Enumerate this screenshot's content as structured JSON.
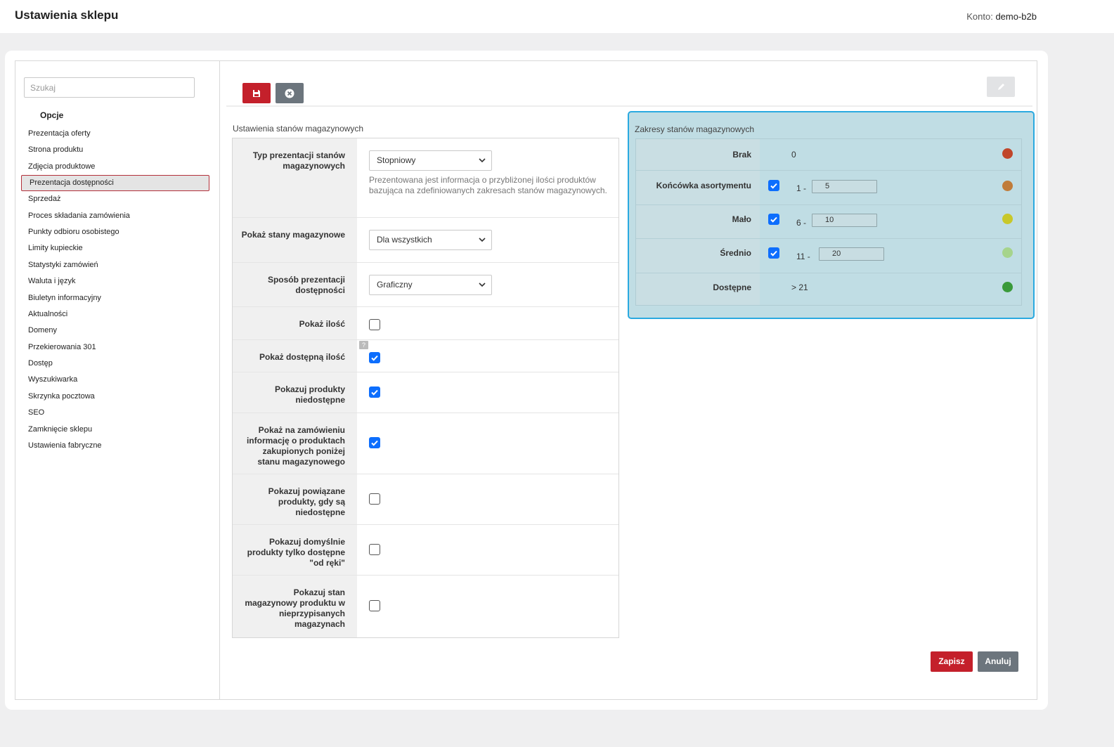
{
  "header": {
    "title": "Ustawienia sklepu",
    "account_label": "Konto:",
    "account_value": "demo-b2b"
  },
  "sidebar": {
    "search_placeholder": "Szukaj",
    "section": "Opcje",
    "items": [
      "Prezentacja oferty",
      "Strona produktu",
      "Zdjęcia produktowe",
      "Prezentacja dostępności",
      "Sprzedaż",
      "Proces składania zamówienia",
      "Punkty odbioru osobistego",
      "Limity kupieckie",
      "Statystyki zamówień",
      "Waluta i język",
      "Biuletyn informacyjny",
      "Aktualności",
      "Domeny",
      "Przekierowania 301",
      "Dostęp",
      "Wyszukiwarka",
      "Skrzynka pocztowa",
      "SEO",
      "Zamknięcie sklepu",
      "Ustawienia fabryczne"
    ],
    "active_index": 3
  },
  "toolbar": {
    "save_icon": "floppy-disk-icon",
    "cancel_icon": "x-circle-icon",
    "edit_icon": "pencil-icon"
  },
  "stock": {
    "title": "Ustawienia stanów magazynowych",
    "type_label": "Typ prezentacji stanów magazynowych",
    "type_value": "Stopniowy",
    "type_hint": "Prezentowana jest informacja o przybliżonej ilości produktów bazująca na zdefiniowanych zakresach stanów magazynowych.",
    "show_label": "Pokaż stany magazynowe",
    "show_value": "Dla wszystkich",
    "mode_label": "Sposób prezentacji dostępności",
    "mode_value": "Graficzny",
    "qty_label": "Pokaż ilość",
    "qty_checked": false,
    "avail_qty_label": "Pokaż dostępną ilość",
    "avail_qty_checked": true,
    "help": "?",
    "unavailable_label": "Pokazuj produkty niedostępne",
    "unavailable_checked": true,
    "order_info_label": "Pokaż na zamówieniu informację o produktach zakupionych poniżej stanu magazynowego",
    "order_info_checked": true,
    "related_label": "Pokazuj powiązane produkty, gdy są niedostępne",
    "related_checked": false,
    "default_label": "Pokazuj domyślnie produkty tylko dostępne \"od ręki\"",
    "default_checked": false,
    "unassigned_label": "Pokazuj stan magazynowy produktu w nieprzypisanych magazynach",
    "unassigned_checked": false
  },
  "ranges": {
    "title": "Zakresy stanów magazynowych",
    "rows": [
      {
        "label": "Brak",
        "from": "0",
        "to": "",
        "checked": null,
        "color": "#c0462a"
      },
      {
        "label": "Końcówka asortymentu",
        "from": "1 -",
        "to": "5",
        "checked": true,
        "color": "#c07c3a"
      },
      {
        "label": "Mało",
        "from": "6 -",
        "to": "10",
        "checked": true,
        "color": "#c8c82a"
      },
      {
        "label": "Średnio",
        "from": "11 -",
        "to": "20",
        "checked": true,
        "color": "#a6d48c"
      },
      {
        "label": "Dostępne",
        "from": "> 21",
        "to": "",
        "checked": null,
        "color": "#3a9a3a"
      }
    ]
  },
  "footer": {
    "save_label": "Zapisz",
    "cancel_label": "Anuluj"
  }
}
